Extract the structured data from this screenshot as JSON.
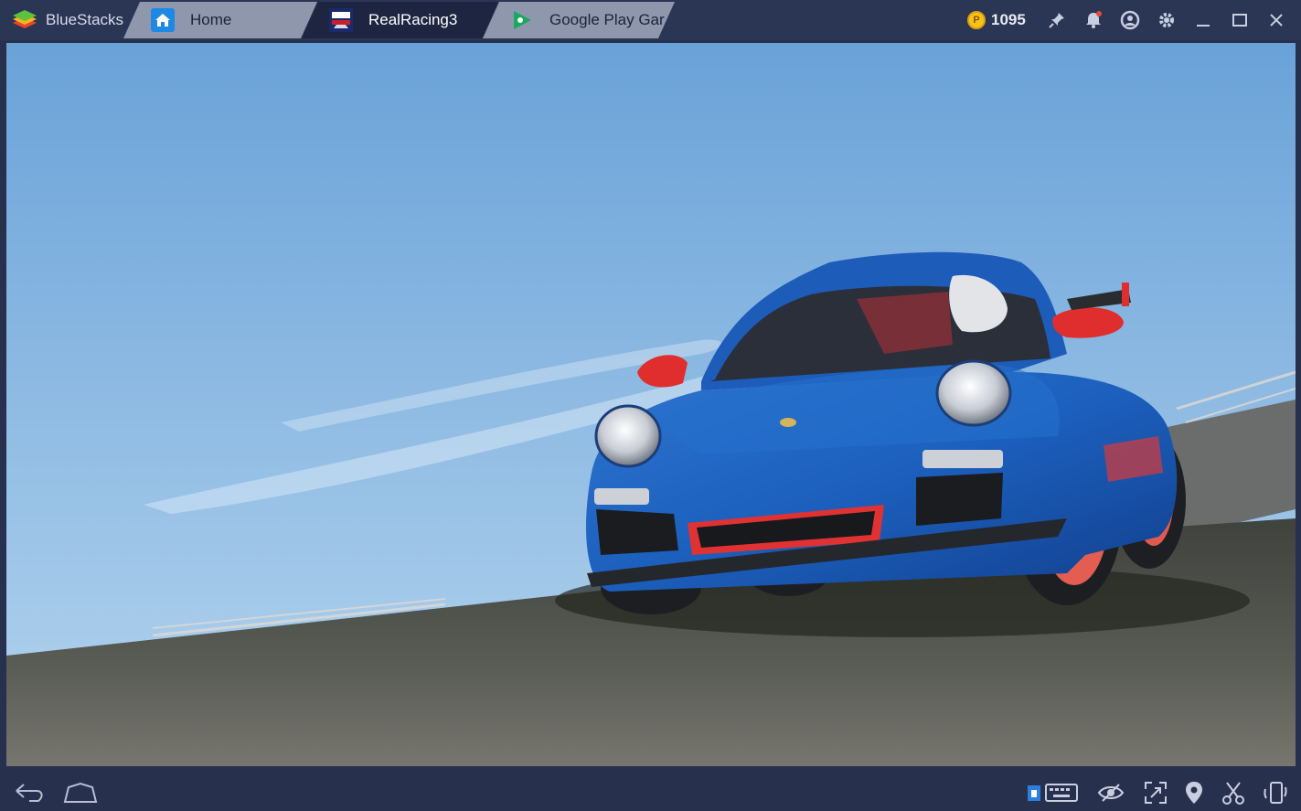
{
  "app": {
    "name": "BlueStacks"
  },
  "tabs": [
    {
      "label": "Home",
      "icon": "home-icon",
      "active": false
    },
    {
      "label": "RealRacing3",
      "icon": "realracing3-app-icon",
      "active": true
    },
    {
      "label": "Google Play Gar",
      "icon": "google-play-games-icon",
      "active": false
    }
  ],
  "toolbar": {
    "coins": "1095",
    "coin_icon": "coin-icon",
    "icons": [
      "pin-icon",
      "notification-bell-icon",
      "account-icon",
      "settings-gear-icon",
      "minimize-icon",
      "maximize-icon",
      "close-icon"
    ],
    "notification_dot_color": "#e84a3a"
  },
  "game": {
    "scene": "car-showcase-3d",
    "car_color": "#1f5fb8",
    "accent_color": "#e23a35"
  },
  "bottombar": {
    "left_icons": [
      "back-icon",
      "home-icon"
    ],
    "right_icons": [
      "keyboard-controls-icon",
      "eye-visibility-icon",
      "fullscreen-icon",
      "location-icon",
      "screenshot-scissors-icon",
      "rotate-device-icon"
    ]
  }
}
